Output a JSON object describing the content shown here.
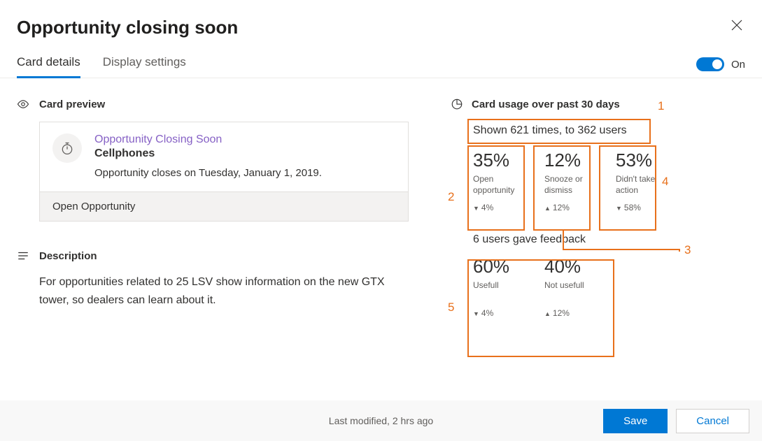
{
  "header": {
    "title": "Opportunity closing soon"
  },
  "tabs": {
    "items": [
      "Card details",
      "Display settings"
    ],
    "active": 0
  },
  "toggle": {
    "label": "On",
    "value": true
  },
  "preview": {
    "section_title": "Card preview",
    "card_title": "Opportunity Closing Soon",
    "card_subtitle": "Cellphones",
    "card_text": "Opportunity closes on Tuesday, January 1, 2019.",
    "action_label": "Open Opportunity"
  },
  "description": {
    "section_title": "Description",
    "text": "For opportunities related to 25 LSV show information on the new GTX tower, so dealers can learn about it."
  },
  "usage": {
    "section_title": "Card usage over past 30 days",
    "summary": "Shown 621 times, to 362 users",
    "stats": [
      {
        "pct": "35%",
        "label": "Open opportunity",
        "delta_dir": "down",
        "delta": "4%"
      },
      {
        "pct": "12%",
        "label": "Snooze or dismiss",
        "delta_dir": "up",
        "delta": "12%"
      },
      {
        "pct": "53%",
        "label": "Didn't take action",
        "delta_dir": "down",
        "delta": "58%"
      }
    ],
    "feedback_title": "6 users gave feedback",
    "feedback": [
      {
        "pct": "60%",
        "label": "Usefull",
        "delta_dir": "down",
        "delta": "4%"
      },
      {
        "pct": "40%",
        "label": "Not usefull",
        "delta_dir": "up",
        "delta": "12%"
      }
    ]
  },
  "annotations": {
    "1": "1",
    "2": "2",
    "3": "3",
    "4": "4",
    "5": "5"
  },
  "footer": {
    "status": "Last modified, 2 hrs ago",
    "save": "Save",
    "cancel": "Cancel"
  }
}
